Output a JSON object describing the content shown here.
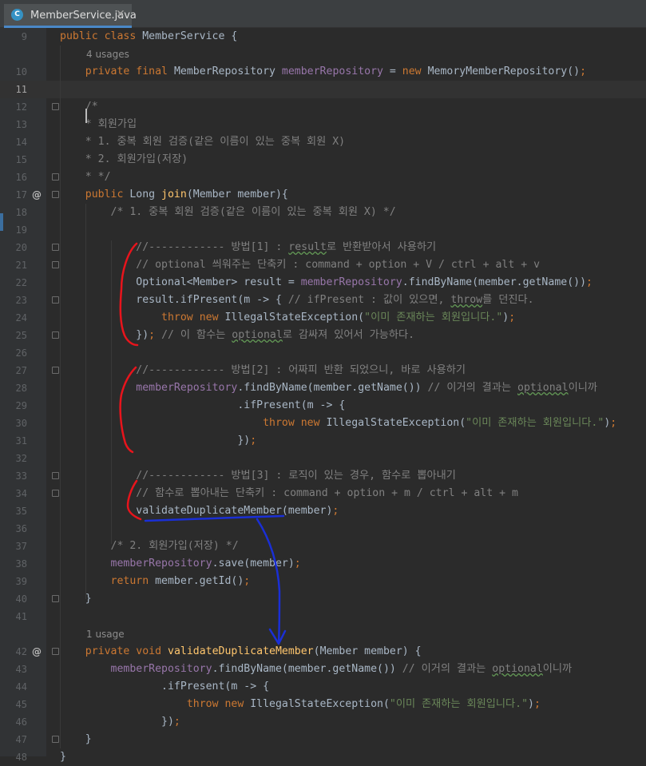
{
  "tab": {
    "title": "MemberService.java",
    "icon": "C",
    "close": "✕"
  },
  "editor": {
    "lines": [
      {
        "n": "9",
        "tokens": [
          [
            "kw",
            "public "
          ],
          [
            "kw",
            "class "
          ],
          [
            "p",
            "MemberService {"
          ]
        ]
      },
      {
        "hint": "4 usages"
      },
      {
        "n": "10",
        "tokens": [
          [
            "kw",
            "private "
          ],
          [
            "kw",
            "final "
          ],
          [
            "p",
            "MemberRepository "
          ],
          [
            "fld",
            "memberRepository"
          ],
          [
            "p",
            " = "
          ],
          [
            "kw",
            "new "
          ],
          [
            "p",
            "MemoryMemberRepository()"
          ],
          [
            "kw",
            ";"
          ]
        ]
      },
      {
        "n": "11",
        "current": true,
        "tokens": []
      },
      {
        "n": "12",
        "fold": true,
        "tokens": [
          [
            "cm",
            "/*"
          ]
        ]
      },
      {
        "n": "13",
        "tokens": [
          [
            "cm",
            "* 회원가입"
          ]
        ]
      },
      {
        "n": "14",
        "tokens": [
          [
            "cm",
            "* 1. 중복 회원 검증(같은 이름이 있는 중복 회원 X)"
          ]
        ]
      },
      {
        "n": "15",
        "tokens": [
          [
            "cm",
            "* 2. 회원가입(저장)"
          ]
        ]
      },
      {
        "n": "16",
        "fold": true,
        "tokens": [
          [
            "cm",
            "* */"
          ]
        ]
      },
      {
        "n": "17",
        "at": true,
        "fold": true,
        "tokens": [
          [
            "kw",
            "public "
          ],
          [
            "p",
            "Long "
          ],
          [
            "fn",
            "join"
          ],
          [
            "p",
            "(Member member){"
          ]
        ]
      },
      {
        "n": "18",
        "tokens": [
          [
            "p",
            "    "
          ],
          [
            "cm",
            "/* 1. 중복 회원 검증(같은 이름이 있는 중복 회원 X) */"
          ]
        ]
      },
      {
        "n": "19",
        "tokens": []
      },
      {
        "n": "20",
        "fold": true,
        "tokens": [
          [
            "p",
            "        "
          ],
          [
            "cm",
            "//------------ 방법[1] : "
          ],
          [
            "cm ul",
            "result"
          ],
          [
            "cm",
            "로 반환받아서 사용하기"
          ]
        ]
      },
      {
        "n": "21",
        "fold": true,
        "tokens": [
          [
            "p",
            "        "
          ],
          [
            "cm",
            "// optional 씌워주는 단축키 : command + option + V / ctrl + alt + v"
          ]
        ]
      },
      {
        "n": "22",
        "tokens": [
          [
            "p",
            "        Optional<Member> result = "
          ],
          [
            "fld",
            "memberRepository"
          ],
          [
            "p",
            ".findByName(member.getName())"
          ],
          [
            "kw",
            ";"
          ]
        ]
      },
      {
        "n": "23",
        "fold": true,
        "tokens": [
          [
            "p",
            "        result.ifPresent(m -> { "
          ],
          [
            "cm",
            "// ifPresent : 값이 있으면, "
          ],
          [
            "cm ul",
            "throw"
          ],
          [
            "cm",
            "를 던진다."
          ]
        ]
      },
      {
        "n": "24",
        "tokens": [
          [
            "p",
            "            "
          ],
          [
            "kw",
            "throw "
          ],
          [
            "kw",
            "new "
          ],
          [
            "p",
            "IllegalStateException("
          ],
          [
            "str",
            "\"이미 존재하는 회원입니다.\""
          ],
          [
            "p",
            ")"
          ],
          [
            "kw",
            ";"
          ]
        ]
      },
      {
        "n": "25",
        "fold": true,
        "tokens": [
          [
            "p",
            "        })"
          ],
          [
            "kw",
            "; "
          ],
          [
            "cm",
            "// 이 함수는 "
          ],
          [
            "cm ul",
            "optional"
          ],
          [
            "cm",
            "로 감싸져 있어서 가능하다."
          ]
        ]
      },
      {
        "n": "26",
        "tokens": []
      },
      {
        "n": "27",
        "fold": true,
        "tokens": [
          [
            "p",
            "        "
          ],
          [
            "cm",
            "//------------ 방법[2] : 어짜피 반환 되었으니, 바로 사용하기"
          ]
        ]
      },
      {
        "n": "28",
        "tokens": [
          [
            "p",
            "        "
          ],
          [
            "fld",
            "memberRepository"
          ],
          [
            "p",
            ".findByName(member.getName()) "
          ],
          [
            "cm",
            "// 이거의 결과는 "
          ],
          [
            "cm ul",
            "optional"
          ],
          [
            "cm",
            "이니까"
          ]
        ]
      },
      {
        "n": "29",
        "tokens": [
          [
            "p",
            "                        .ifPresent(m -> {"
          ]
        ]
      },
      {
        "n": "30",
        "tokens": [
          [
            "p",
            "                            "
          ],
          [
            "kw",
            "throw "
          ],
          [
            "kw",
            "new "
          ],
          [
            "p",
            "IllegalStateException("
          ],
          [
            "str",
            "\"이미 존재하는 회원입니다.\""
          ],
          [
            "p",
            ")"
          ],
          [
            "kw",
            ";"
          ]
        ]
      },
      {
        "n": "31",
        "tokens": [
          [
            "p",
            "                        })"
          ],
          [
            "kw",
            ";"
          ]
        ]
      },
      {
        "n": "32",
        "tokens": []
      },
      {
        "n": "33",
        "fold": true,
        "tokens": [
          [
            "p",
            "        "
          ],
          [
            "cm",
            "//------------ 방법[3] : 로직이 있는 경우, 함수로 뽑아내기"
          ]
        ]
      },
      {
        "n": "34",
        "fold": true,
        "tokens": [
          [
            "p",
            "        "
          ],
          [
            "cm",
            "// 함수로 뽑아내는 단축키 : command + option + m / ctrl + alt + m"
          ]
        ]
      },
      {
        "n": "35",
        "tokens": [
          [
            "p",
            "        validateDuplicateMember(member)"
          ],
          [
            "kw",
            ";"
          ]
        ]
      },
      {
        "n": "36",
        "tokens": []
      },
      {
        "n": "37",
        "tokens": [
          [
            "p",
            "    "
          ],
          [
            "cm",
            "/* 2. 회원가입(저장) */"
          ]
        ]
      },
      {
        "n": "38",
        "tokens": [
          [
            "p",
            "    "
          ],
          [
            "fld",
            "memberRepository"
          ],
          [
            "p",
            ".save(member)"
          ],
          [
            "kw",
            ";"
          ]
        ]
      },
      {
        "n": "39",
        "tokens": [
          [
            "p",
            "    "
          ],
          [
            "kw",
            "return "
          ],
          [
            "p",
            "member.getId()"
          ],
          [
            "kw",
            ";"
          ]
        ]
      },
      {
        "n": "40",
        "fold": true,
        "tokens": [
          [
            "p",
            "}"
          ]
        ]
      },
      {
        "n": "41",
        "tokens": []
      },
      {
        "hint": "1 usage"
      },
      {
        "n": "42",
        "at": true,
        "fold": true,
        "tokens": [
          [
            "kw",
            "private "
          ],
          [
            "kw",
            "void "
          ],
          [
            "fn",
            "validateDuplicateMember"
          ],
          [
            "p",
            "(Member member) {"
          ]
        ]
      },
      {
        "n": "43",
        "tokens": [
          [
            "p",
            "    "
          ],
          [
            "fld",
            "memberRepository"
          ],
          [
            "p",
            ".findByName(member.getName()) "
          ],
          [
            "cm",
            "// 이거의 결과는 "
          ],
          [
            "cm ul",
            "optional"
          ],
          [
            "cm",
            "이니까"
          ]
        ]
      },
      {
        "n": "44",
        "tokens": [
          [
            "p",
            "            .ifPresent(m -> {"
          ]
        ]
      },
      {
        "n": "45",
        "tokens": [
          [
            "p",
            "                "
          ],
          [
            "kw",
            "throw "
          ],
          [
            "kw",
            "new "
          ],
          [
            "p",
            "IllegalStateException("
          ],
          [
            "str",
            "\"이미 존재하는 회원입니다.\""
          ],
          [
            "p",
            ")"
          ],
          [
            "kw",
            ";"
          ]
        ]
      },
      {
        "n": "46",
        "tokens": [
          [
            "p",
            "            })"
          ],
          [
            "kw",
            ";"
          ]
        ]
      },
      {
        "n": "47",
        "fold": true,
        "tokens": [
          [
            "p",
            "}"
          ]
        ]
      },
      {
        "n": "48",
        "tokens": [
          [
            "p",
            "}"
          ]
        ]
      }
    ]
  },
  "colors": {
    "keyword": "#cc7832",
    "field": "#9876aa",
    "string": "#6a8759",
    "comment": "#808080",
    "method": "#ffc66d",
    "text": "#a9b7c6",
    "red_annotation": "#e8141c",
    "blue_annotation": "#1a2fd6"
  }
}
